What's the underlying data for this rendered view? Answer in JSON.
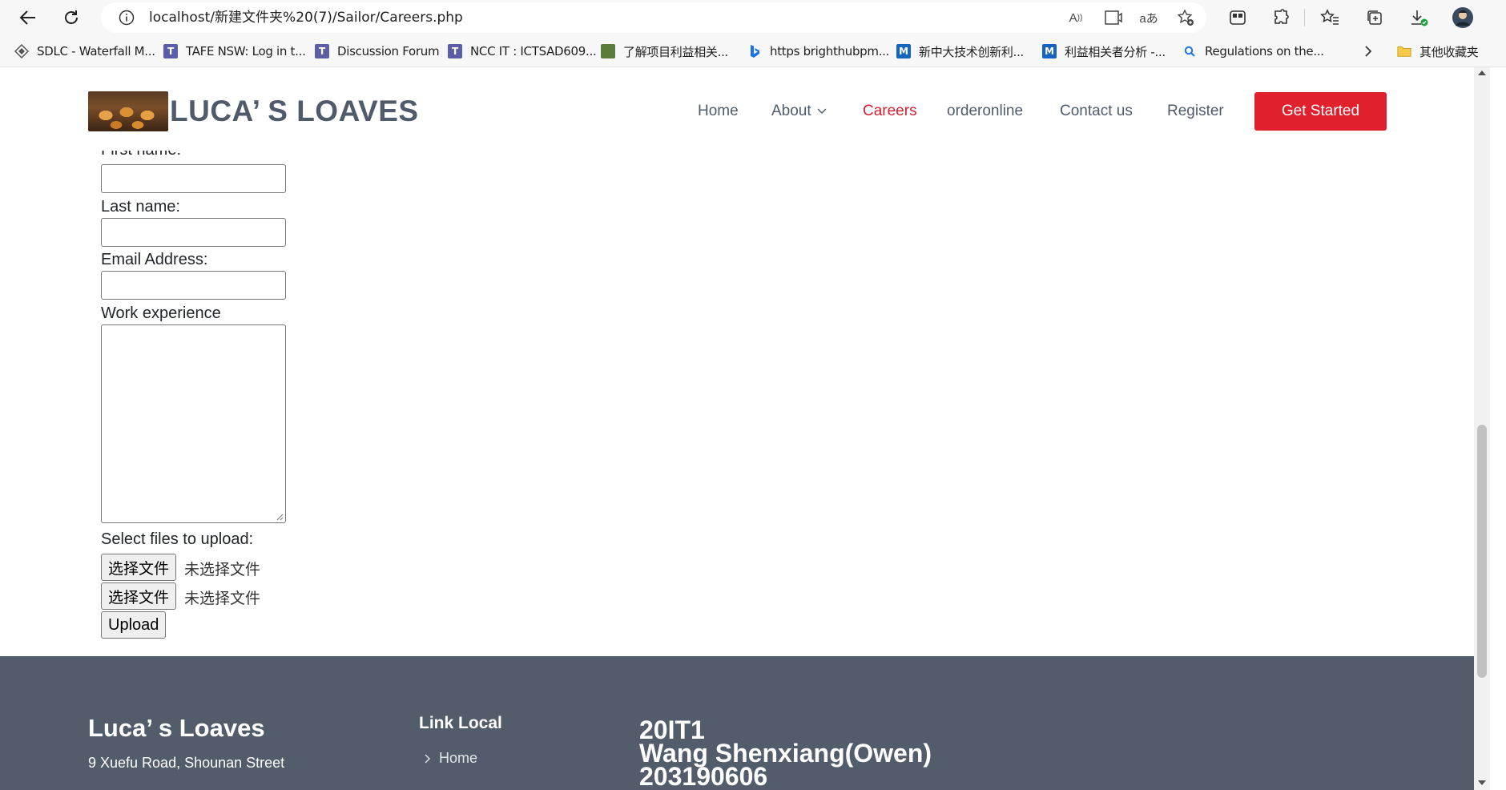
{
  "browser": {
    "url": "localhost/新建文件夹%20(7)/Sailor/Careers.php",
    "bookmarks": [
      {
        "label": "SDLC - Waterfall M...",
        "icon": "sdlc-icon"
      },
      {
        "label": "TAFE NSW: Log in t...",
        "icon": "tafe-icon"
      },
      {
        "label": "Discussion Forum",
        "icon": "tafe-icon"
      },
      {
        "label": "NCC IT : ICTSAD609...",
        "icon": "tafe-icon"
      },
      {
        "label": "了解项目利益相关...",
        "icon": "green-book-icon"
      },
      {
        "label": "https brighthubpm...",
        "icon": "bing-icon"
      },
      {
        "label": "新中大技术创新利...",
        "icon": "m-icon"
      },
      {
        "label": "利益相关者分析 -...",
        "icon": "m-icon"
      },
      {
        "label": "Regulations on the...",
        "icon": "search-icon"
      }
    ],
    "other_bookmarks": "其他收藏夹"
  },
  "site": {
    "logo_text": "LUCA’ S LOAVES",
    "nav": {
      "home": "Home",
      "about": "About",
      "careers": "Careers",
      "orderonline": "orderonline",
      "contact": "Contact us",
      "register": "Register"
    },
    "cta": "Get Started",
    "accent_color": "#e0202c"
  },
  "form": {
    "first_name_label": "First name:",
    "last_name_label": "Last name:",
    "email_label": "Email Address:",
    "experience_label": "Work experience",
    "upload_label": "Select files to upload:",
    "file_button": "选择文件",
    "file_status": "未选择文件",
    "upload_button": "Upload"
  },
  "footer": {
    "brand": "Luca’ s Loaves",
    "address": "9 Xuefu Road, Shounan Street",
    "links_title": "Link Local",
    "links": [
      "Home"
    ],
    "info_line1": "20IT1",
    "info_line2": "Wang Shenxiang(Owen)",
    "info_line3": "203190606"
  }
}
